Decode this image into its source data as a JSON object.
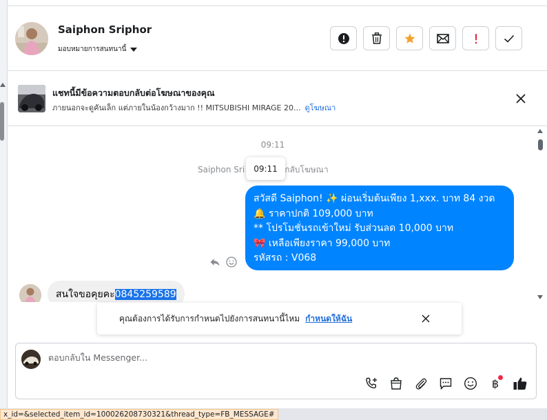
{
  "header": {
    "contact_name": "Saiphon Sriphor",
    "assign_label": "มอบหมายการสนทนานี้",
    "actions": [
      {
        "name": "mark-spam-button",
        "icon": "exclamation-circle-icon"
      },
      {
        "name": "delete-button",
        "icon": "trash-icon"
      },
      {
        "name": "star-button",
        "icon": "star-icon"
      },
      {
        "name": "mark-unread-button",
        "icon": "envelope-icon"
      },
      {
        "name": "follow-up-button",
        "icon": "exclamation-icon"
      },
      {
        "name": "mark-done-button",
        "icon": "check-icon"
      }
    ]
  },
  "ad_banner": {
    "title": "แชทนี้มีข้อความตอบกลับต่อโฆษณาของคุณ",
    "description": "ภายนอกจะดูคันเล็ก แต่ภายในน้องกว้างมาก !! MITSUBISHI MIRAGE 20...",
    "link": "ดูโฆษณา"
  },
  "chat": {
    "timestamp": "09:11",
    "reply_note_prefix": "Saiphon Sri",
    "reply_note_suffix": "กลับโฆษณา",
    "tooltip_time": "09:11",
    "outgoing_lines": [
      "สวัสดี Saiphon! ✨  ผ่อนเริ่มต้นเพียง 1,xxx. บาท 84 งวด",
      "ราคาปกติ 109,000 บาท",
      "** โปรโมชั่นรถเข้าใหม่ รับส่วนลด 10,000 บาท",
      " เหลือเพียงราคา 99,000 บาท",
      " รหัสรถ : V068"
    ],
    "incoming_text": "สนใจขอคุยคะ",
    "incoming_selected": "0845259589"
  },
  "followup_prompt": {
    "text": "คุณต้องการได้รับการกำหนดไปยังการสนทนานี้ไหม",
    "link": "กำหนดให้ฉัน"
  },
  "composer": {
    "placeholder": "ตอบกลับใน Messenger..."
  },
  "status_url": "x_id=&selected_item_id=100026208730321&thread_type=FB_MESSAGE#",
  "colors": {
    "messenger_blue": "#0084ff",
    "link_blue": "#216fdb",
    "star_orange": "#f4a22e",
    "alert_red": "#e41e3f"
  }
}
